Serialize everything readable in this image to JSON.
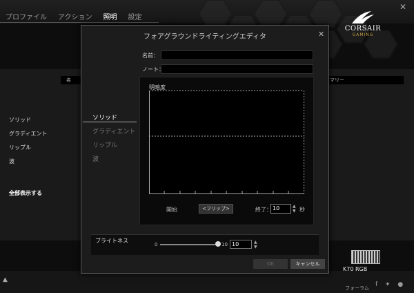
{
  "app": {
    "tabs": [
      {
        "label": "プロファイル"
      },
      {
        "label": "アクション"
      },
      {
        "label": "照明"
      },
      {
        "label": "設定"
      }
    ],
    "active_tab": "照明",
    "logo": {
      "brand": "CORSAIR",
      "sub": "GAMING"
    }
  },
  "background": {
    "left_menu": [
      "ソリッド",
      "グラディエント",
      "リップル",
      "波"
    ],
    "show_all": "全部表示する",
    "field_left_fragment": "名",
    "field_right_fragment": "マリー",
    "device_label": "K70 RGB",
    "bottom_text": "フォーラム"
  },
  "modal": {
    "title": "フォアグラウンドライティングエディタ",
    "name_label": "名前：",
    "name_value": "",
    "note_label": "ノート：",
    "note_value": "",
    "menu": [
      {
        "label": "ソリッド",
        "active": true
      },
      {
        "label": "グラディエント",
        "active": false
      },
      {
        "label": "リップル",
        "active": false
      },
      {
        "label": "波",
        "active": false
      }
    ],
    "graph_label": "明暗度",
    "start_label": "開始",
    "flip_label": "<フリップ>",
    "end_label": "終了：",
    "end_value": "10",
    "seconds_label": "秒",
    "brightness": {
      "label": "ブライトネス",
      "min": "0",
      "max": "10",
      "value": "10",
      "fraction": 1.0
    },
    "ok_label": "OK",
    "cancel_label": "キャンセル"
  },
  "colors": {
    "accent": "#c0a040"
  }
}
